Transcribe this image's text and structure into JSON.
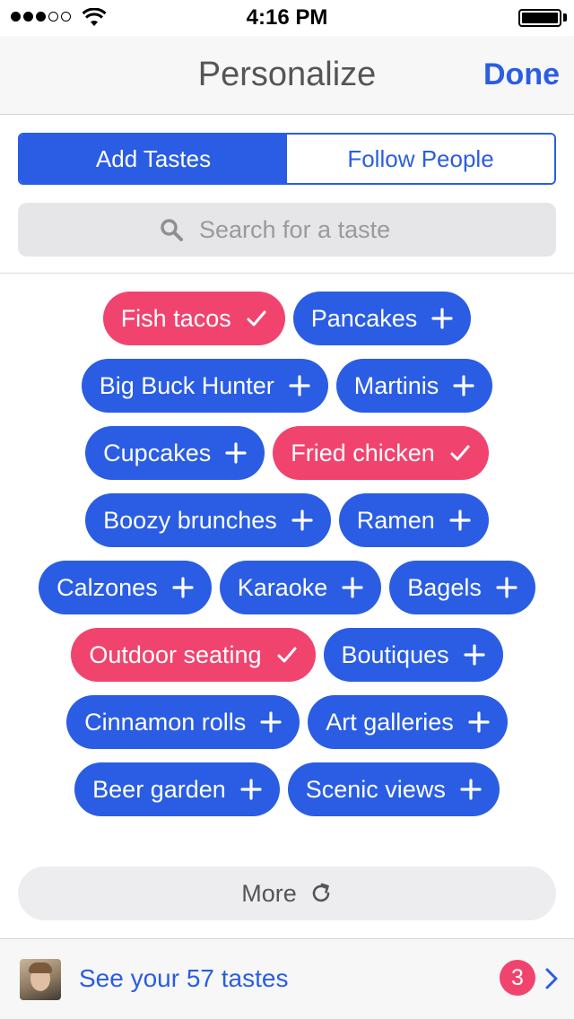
{
  "status_bar": {
    "time": "4:16 PM",
    "signal_bars_filled": 3,
    "signal_bars_total": 5,
    "icons": [
      "signal-dots-icon",
      "wifi-icon",
      "battery-icon"
    ]
  },
  "nav": {
    "title": "Personalize",
    "done_label": "Done"
  },
  "segments": {
    "add_tastes": "Add Tastes",
    "follow_people": "Follow People",
    "active": "add_tastes"
  },
  "search": {
    "placeholder": "Search for a taste",
    "icon": "search-icon"
  },
  "tags": [
    {
      "label": "Fish tacos",
      "selected": true
    },
    {
      "label": "Pancakes",
      "selected": false
    },
    {
      "label": "Big Buck Hunter",
      "selected": false
    },
    {
      "label": "Martinis",
      "selected": false
    },
    {
      "label": "Cupcakes",
      "selected": false
    },
    {
      "label": "Fried chicken",
      "selected": true
    },
    {
      "label": "Boozy brunches",
      "selected": false
    },
    {
      "label": "Ramen",
      "selected": false
    },
    {
      "label": "Calzones",
      "selected": false
    },
    {
      "label": "Karaoke",
      "selected": false
    },
    {
      "label": "Bagels",
      "selected": false
    },
    {
      "label": "Outdoor seating",
      "selected": true
    },
    {
      "label": "Boutiques",
      "selected": false
    },
    {
      "label": "Cinnamon rolls",
      "selected": false
    },
    {
      "label": "Art galleries",
      "selected": false
    },
    {
      "label": "Beer garden",
      "selected": false
    },
    {
      "label": "Scenic views",
      "selected": false
    }
  ],
  "more": {
    "label": "More",
    "icon": "refresh-icon"
  },
  "bottom": {
    "text": "See your 57 tastes",
    "badge_count": "3"
  },
  "colors": {
    "accent_blue": "#2a5de3",
    "selected_pink": "#f0446f",
    "nav_background": "#f7f7f8"
  }
}
